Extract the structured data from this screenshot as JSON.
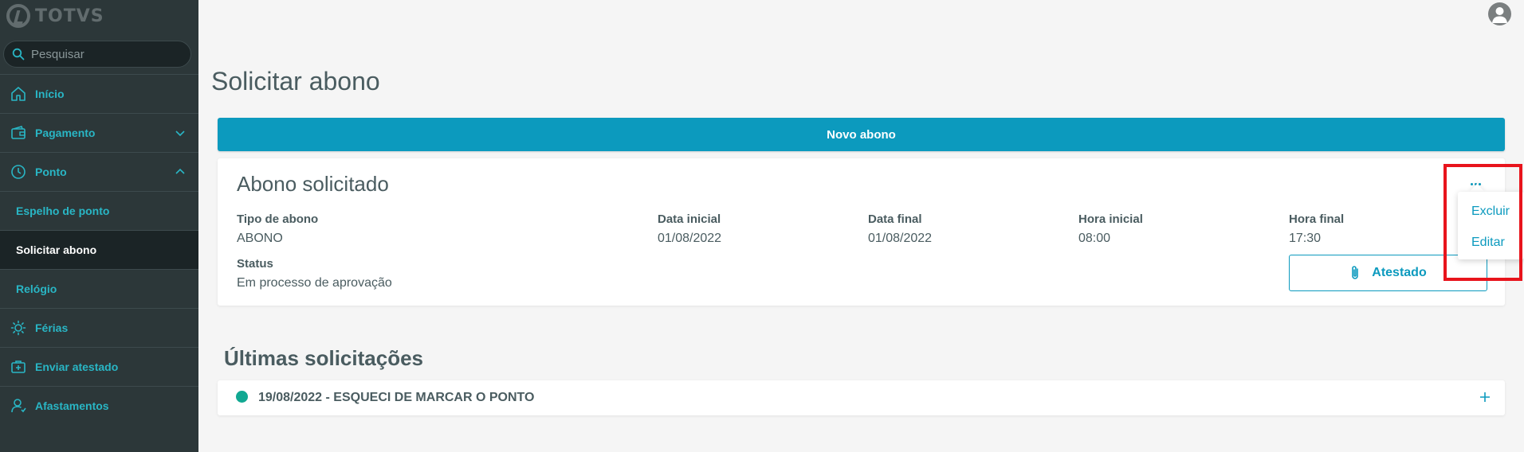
{
  "app": {
    "logo_text": "TOTVS"
  },
  "search": {
    "placeholder": "Pesquisar"
  },
  "sidebar": {
    "items": [
      {
        "label": "Início",
        "icon": "home-icon"
      },
      {
        "label": "Pagamento",
        "icon": "wallet-icon",
        "expanded": false
      },
      {
        "label": "Ponto",
        "icon": "clock-icon",
        "expanded": true
      },
      {
        "label": "Espelho de ponto"
      },
      {
        "label": "Solicitar abono",
        "active": true
      },
      {
        "label": "Relógio"
      },
      {
        "label": "Férias",
        "icon": "sun-icon"
      },
      {
        "label": "Enviar atestado",
        "icon": "medical-kit-icon"
      },
      {
        "label": "Afastamentos",
        "icon": "person-icon"
      }
    ]
  },
  "header": {
    "avatar": "user-avatar-icon"
  },
  "main": {
    "title": "Solicitar abono",
    "new_button": "Novo abono",
    "card": {
      "title": "Abono solicitado",
      "fields": {
        "tipo_label": "Tipo de abono",
        "tipo_value": "ABONO",
        "data_inicial_label": "Data inicial",
        "data_inicial_value": "01/08/2022",
        "data_final_label": "Data final",
        "data_final_value": "01/08/2022",
        "hora_inicial_label": "Hora inicial",
        "hora_inicial_value": "08:00",
        "hora_final_label": "Hora final",
        "hora_final_value": "17:30",
        "status_label": "Status",
        "status_value": "Em processo de aprovação"
      },
      "attach_button": "Atestado",
      "menu": {
        "excluir": "Excluir",
        "editar": "Editar"
      }
    },
    "recent": {
      "title": "Últimas solicitações",
      "items": [
        {
          "text": "19/08/2022 - ESQUECI DE MARCAR O PONTO",
          "status_color": "#11a892"
        }
      ]
    }
  },
  "colors": {
    "accent": "#0c9abe",
    "sidebar_bg": "#2c3739",
    "nav_link": "#29b6c5",
    "highlight": "#e8141c",
    "status_ok": "#11a892"
  }
}
